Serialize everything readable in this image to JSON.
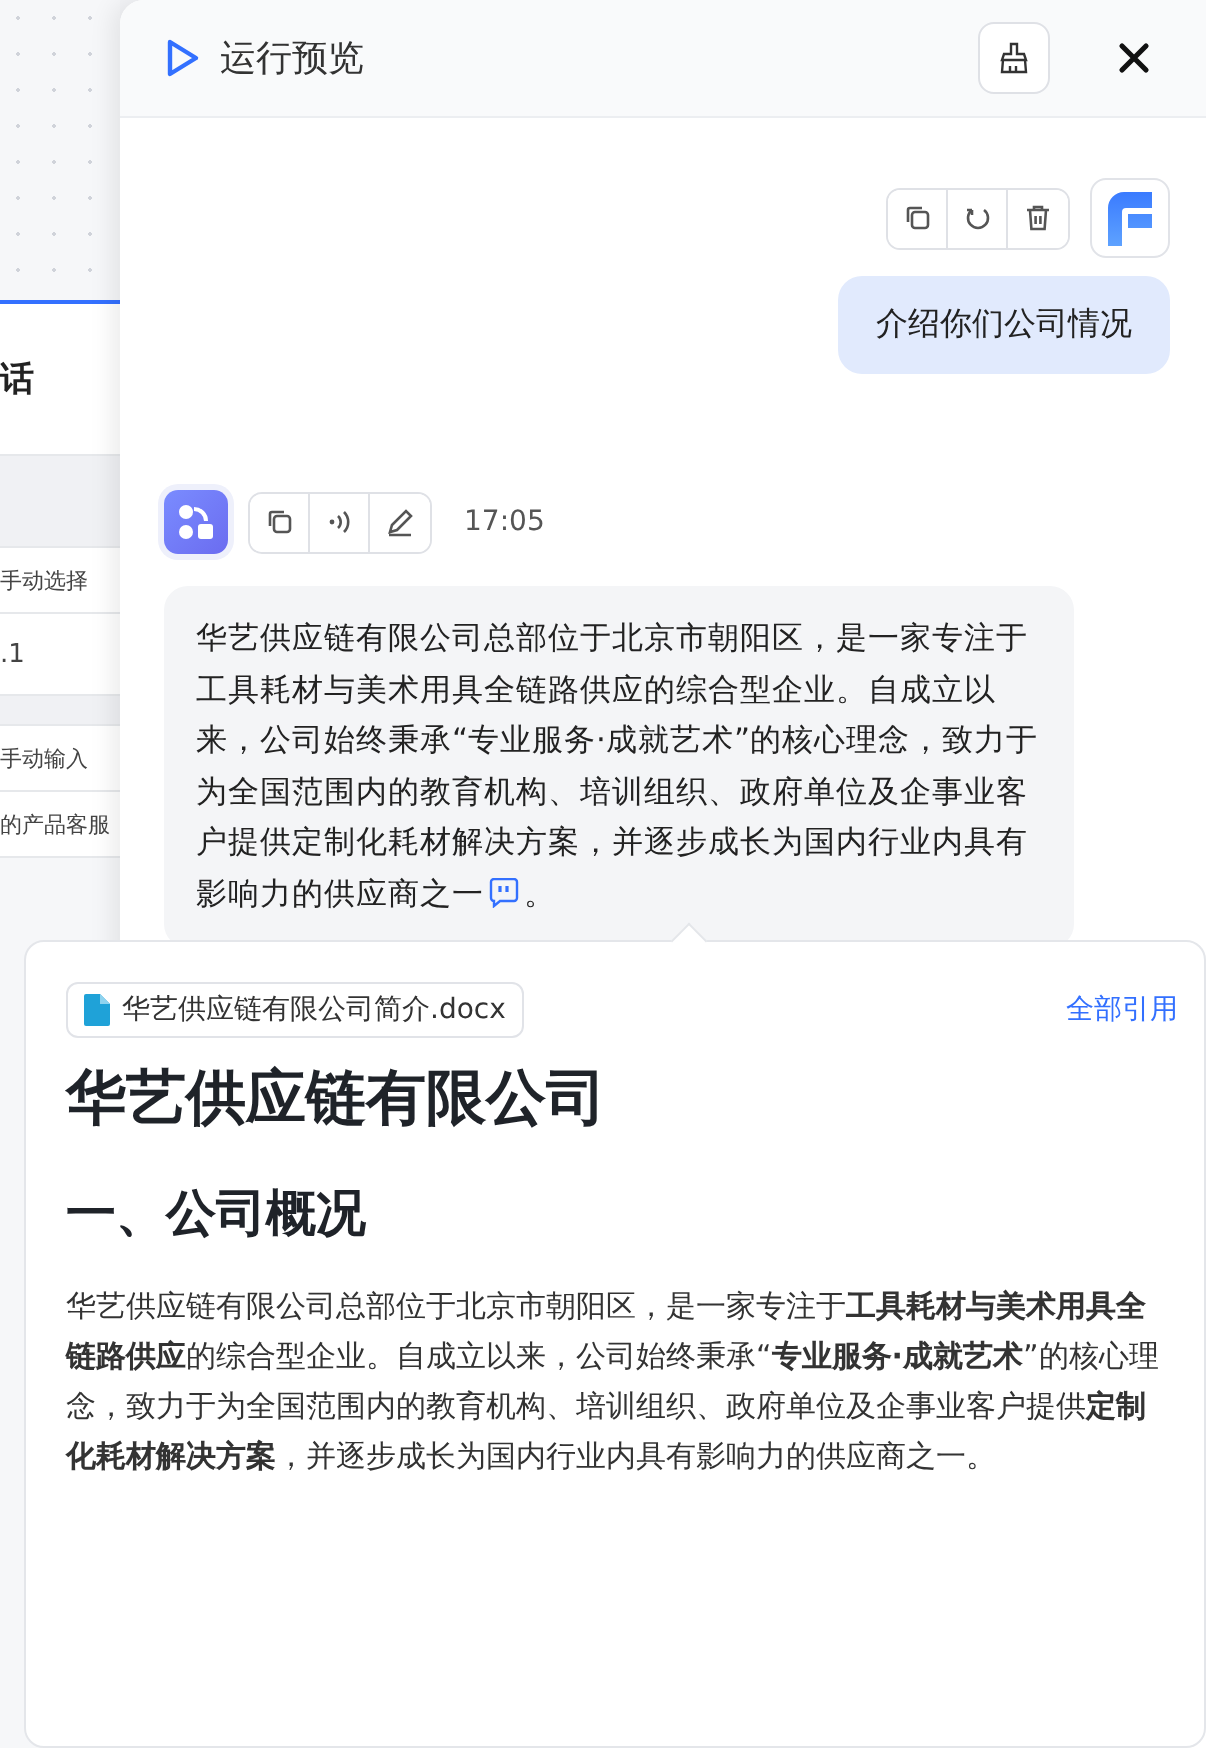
{
  "background": {
    "texts": [
      "话",
      "手动选择",
      ".1",
      "手动输入",
      "的产品客服"
    ]
  },
  "drawer": {
    "title": "运行预览"
  },
  "user_message": {
    "text": "介绍你们公司情况"
  },
  "bot_message": {
    "time": "17:05",
    "text": "华艺供应链有限公司总部位于北京市朝阳区，是一家专注于工具耗材与美术用具全链路供应的综合型企业。自成立以来，公司始终秉承“专业服务·成就艺术”的核心理念，致力于为全国范围内的教育机构、培训组织、政府单位及企事业客户提供定制化耗材解决方案，并逐步成长为国内行业内具有影响力的供应商之一",
    "end": "。"
  },
  "citation": {
    "file": "华艺供应链有限公司简介.docx",
    "action": "全部引用",
    "title": "华艺供应链有限公司",
    "heading": "一、公司概况",
    "paragraph": "华艺供应链有限公司总部位于北京市朝阳区，是一家专注于**工具耗材与美术用具全链路供应**的综合型企业。自成立以来，公司始终秉承“**专业服务·成就艺术**”的核心理念，致力于为全国范围内的教育机构、培训组织、政府单位及企事业客户提供**定制化耗材解决方案**，并逐步成长为国内行业内具有影响力的供应商之一。"
  }
}
